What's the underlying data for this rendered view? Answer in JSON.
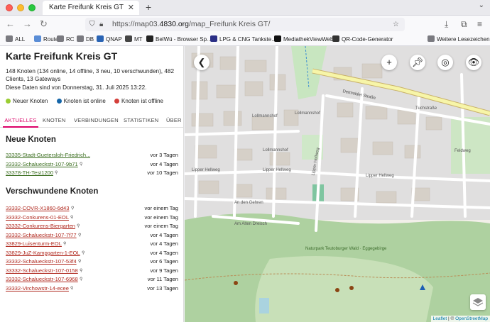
{
  "browser": {
    "tab_title": "Karte Freifunk Kreis GT",
    "url_prefix": "https://map03.",
    "url_domain": "4830.org",
    "url_suffix": "/map_Freifunk Kreis GT/",
    "bookmarks": [
      {
        "label": "ALL",
        "icon": "folder-icon",
        "color": "#7a7a80"
      },
      {
        "label": "Router",
        "icon": "globe-icon",
        "color": "#5a8dd6"
      },
      {
        "label": "RC",
        "icon": "folder-icon",
        "color": "#7a7a80"
      },
      {
        "label": "DB",
        "icon": "folder-icon",
        "color": "#7a7a80"
      },
      {
        "label": "QNAP",
        "icon": "qnap-icon",
        "color": "#2a64b4"
      },
      {
        "label": "MT",
        "icon": "gear-icon",
        "color": "#444444"
      },
      {
        "label": "BelWü - Browser Sp...",
        "icon": "belwue-icon",
        "color": "#222222"
      },
      {
        "label": "LPG & CNG Tankste...",
        "icon": "tank-icon",
        "color": "#2b2f86"
      },
      {
        "label": "MediathekViewWeb",
        "icon": "mediathek-icon",
        "color": "#111111"
      },
      {
        "label": "QR-Code-Generator",
        "icon": "qr-icon",
        "color": "#333333"
      },
      {
        "label": "Weitere Lesezeichen",
        "icon": "folder-icon",
        "color": "#7a7a80"
      }
    ]
  },
  "sidebar": {
    "title": "Karte Freifunk Kreis GT",
    "stats_line": "148 Knoten (134 online, 14 offline, 3 neu, 10 verschwunden), 482 Clients, 13 Gateways",
    "date_line": "Diese Daten sind von Donnerstag, 31. Juli 2025 13:22.",
    "legend": [
      {
        "label": "Neuer Knoten",
        "color": "#9acd32"
      },
      {
        "label": "Knoten ist online",
        "color": "#1566a9"
      },
      {
        "label": "Knoten ist offline",
        "color": "#d43f3a"
      }
    ],
    "tabs": [
      "AKTUELLES",
      "KNOTEN",
      "VERBINDUNGEN",
      "STATISTIKEN",
      "ÜBER"
    ],
    "new_title": "Neue Knoten",
    "new_nodes": [
      {
        "name": "33335-Stadt-Guetersloh-Friedrich...",
        "time": "vor 3 Tagen",
        "pin": false
      },
      {
        "name": "33332-Schalueckstr-107-9b71",
        "time": "vor 4 Tagen",
        "pin": true
      },
      {
        "name": "33378-TH-Test1200",
        "time": "vor 10 Tagen",
        "pin": true
      }
    ],
    "gone_title": "Verschwundene Knoten",
    "gone_nodes": [
      {
        "name": "33332-COVR-X1860-6d43",
        "time": "vor einem Tag"
      },
      {
        "name": "33332-Conkurens-01-EOL",
        "time": "vor einem Tag"
      },
      {
        "name": "33332-Conkurens-Biergarten",
        "time": "vor einem Tag"
      },
      {
        "name": "33332-Schalueckstr-107-7f77",
        "time": "vor 4 Tagen"
      },
      {
        "name": "33829-Luisenturm-EOL",
        "time": "vor 4 Tagen"
      },
      {
        "name": "33829-JuZ-Kampgarten-1-EOL",
        "time": "vor 4 Tagen"
      },
      {
        "name": "33332-Schalueckstr-107-53f4",
        "time": "vor 6 Tagen"
      },
      {
        "name": "33332-Schalueckstr-107-0158",
        "time": "vor 9 Tagen"
      },
      {
        "name": "33332-Schalueckstr-107-6968",
        "time": "vor 11 Tagen"
      },
      {
        "name": "33332-Virchowstr-14-ecee",
        "time": "vor 13 Tagen"
      }
    ]
  },
  "map": {
    "attribution_leaflet": "Leaflet",
    "attribution_sep": " | © ",
    "attribution_osm": "OpenStreetMap",
    "streets": {
      "detmolder": "Detmolder Straße",
      "lollmannshof1": "Lollmannshof",
      "lollmannshof2": "Lollmannshof",
      "lollmannshof3": "Lollmannshof",
      "lipper1": "Lipper Hellweg",
      "lipper2": "Lipper Hellweg",
      "lipper3": "Lipper Hellweg",
      "lipper4": "Lipper Hellweg",
      "gehren": "An den Gehren",
      "dreisch": "Am Alten Dreisch",
      "tuchstr": "Tuchstraße",
      "feldweg": "Feldweg",
      "naturpark": "Naturpark Teutoburger Wald · Eggegebirge"
    }
  }
}
